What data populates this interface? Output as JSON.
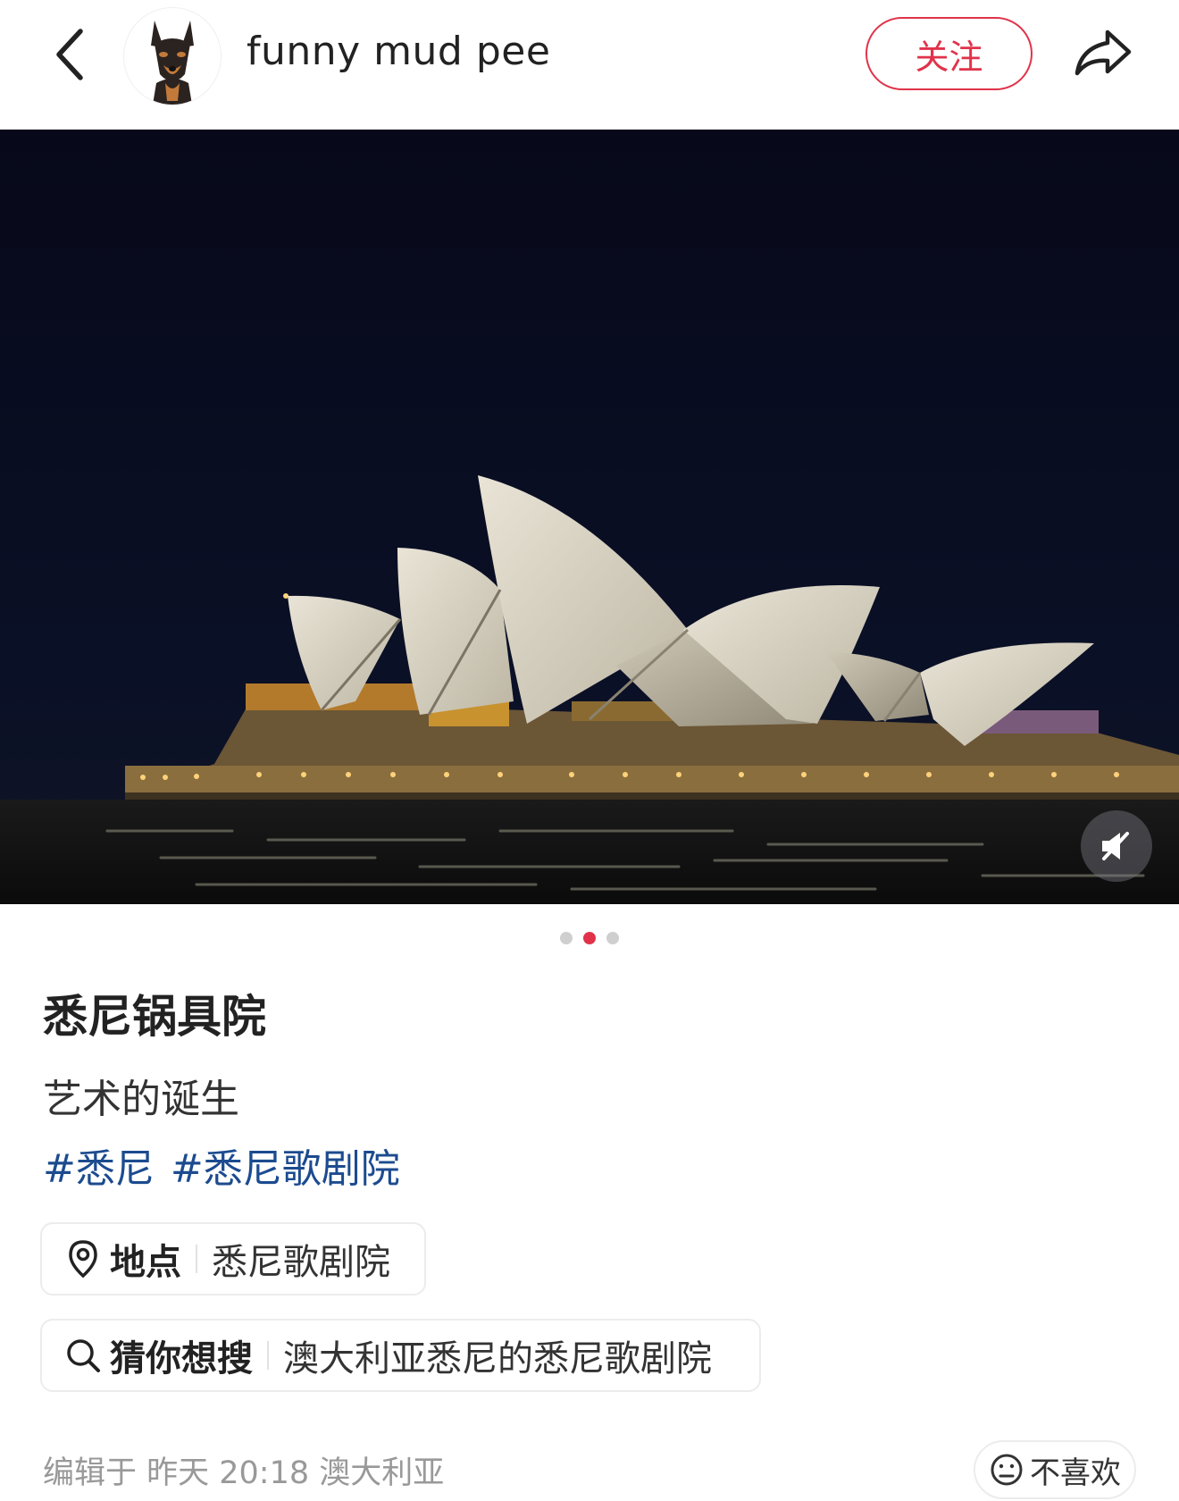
{
  "header": {
    "back_icon": "chevron-left-icon",
    "username": "funny mud pee",
    "follow_label": "关注",
    "share_icon": "share-arrow-icon",
    "accent_color": "#e0334a"
  },
  "media": {
    "carousel": {
      "count": 3,
      "active_index": 1
    },
    "mute_icon": "speaker-muted-icon"
  },
  "post": {
    "title": "悉尼锅具院",
    "description": "艺术的诞生",
    "tags": [
      "#悉尼",
      "#悉尼歌剧院"
    ],
    "tag_color": "#1c4b8f"
  },
  "location_chip": {
    "icon": "location-pin-icon",
    "label": "地点",
    "value": "悉尼歌剧院"
  },
  "search_chip": {
    "icon": "search-icon",
    "label": "猜你想搜",
    "value": "澳大利亚悉尼的悉尼歌剧院"
  },
  "footer": {
    "meta": "编辑于 昨天 20:18 澳大利亚",
    "dislike_icon": "neutral-face-icon",
    "dislike_label": "不喜欢"
  }
}
